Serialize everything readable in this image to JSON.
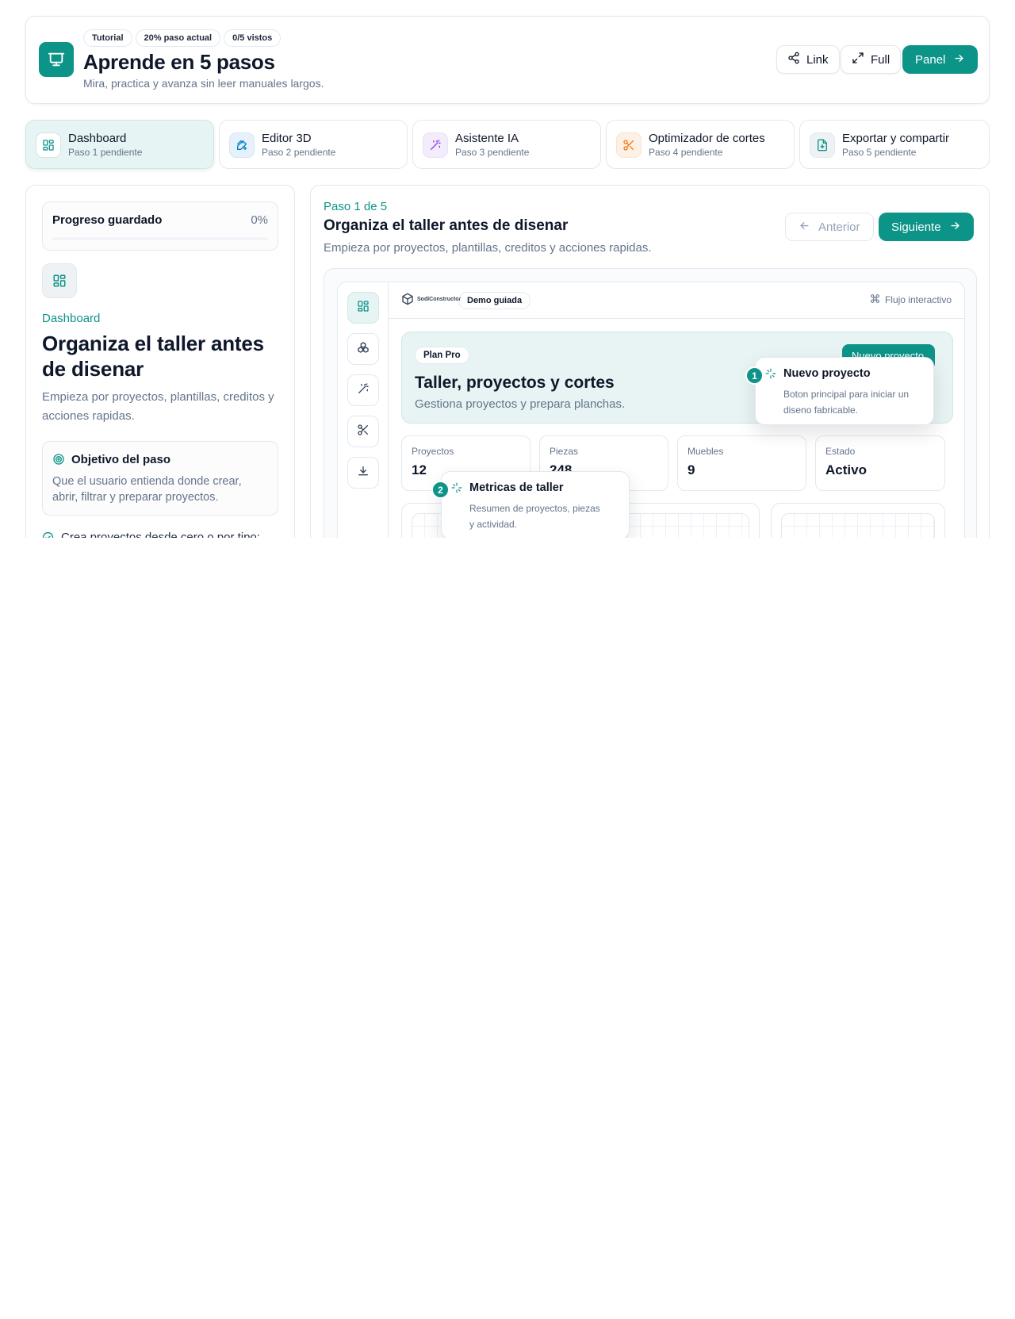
{
  "header": {
    "pills": [
      "Tutorial",
      "20% paso actual",
      "0/5 vistos"
    ],
    "title": "Aprende en 5 pasos",
    "subtitle": "Mira, practica y avanza sin leer manuales largos.",
    "buttons": {
      "link": "Link",
      "full": "Full",
      "panel": "Panel"
    }
  },
  "steps": [
    {
      "title": "Dashboard",
      "status": "Paso 1 pendiente",
      "icon": "dashboard-icon",
      "active": true
    },
    {
      "title": "Editor 3D",
      "status": "Paso 2 pendiente",
      "icon": "ruler-pencil-icon"
    },
    {
      "title": "Asistente IA",
      "status": "Paso 3 pendiente",
      "icon": "magic-wand-icon"
    },
    {
      "title": "Optimizador de cortes",
      "status": "Paso 4 pendiente",
      "icon": "scissors-icon"
    },
    {
      "title": "Exportar y compartir",
      "status": "Paso 5 pendiente",
      "icon": "file-download-icon"
    }
  ],
  "left": {
    "progress_label": "Progreso guardado",
    "progress_value": "0%",
    "progress_fraction": 0,
    "kicker": "Dashboard",
    "title": "Organiza el taller antes de disenar",
    "description": "Empieza por proyectos, plantillas, creditos y acciones rapidas.",
    "goal_title": "Objetivo del paso",
    "goal_text": "Que el usuario entienda donde crear, abrir, filtrar y preparar proyectos.",
    "checklist": [
      "Crea proyectos desde cero o por tipo: mueble, division o casa."
    ]
  },
  "main": {
    "step_indicator": "Paso 1 de 5",
    "title": "Organiza el taller antes de disenar",
    "subtitle": "Empieza por proyectos, plantillas, creditos y acciones rapidas.",
    "prev_label": "Anterior",
    "next_label": "Siguiente"
  },
  "demo": {
    "brand": "SodiConstructor",
    "pill": "Demo guiada",
    "flow_label": "Flujo interactivo",
    "hero": {
      "plan": "Plan Pro",
      "title": "Taller, proyectos y cortes",
      "subtitle": "Gestiona proyectos y prepara planchas.",
      "new_button": "Nuevo proyecto"
    },
    "metrics": [
      {
        "label": "Proyectos",
        "value": "12"
      },
      {
        "label": "Piezas",
        "value": "248"
      },
      {
        "label": "Muebles",
        "value": "9"
      },
      {
        "label": "Estado",
        "value": "Activo"
      }
    ],
    "tooltips": [
      {
        "number": "1",
        "title": "Nuevo proyecto",
        "text": "Boton principal para iniciar un diseno fabricable."
      },
      {
        "number": "2",
        "title": "Metricas de taller",
        "text": "Resumen de proyectos, piezas y actividad."
      }
    ]
  },
  "colors": {
    "accent": "#0d9488",
    "muted": "#64748b",
    "border": "#e2e8f0"
  }
}
